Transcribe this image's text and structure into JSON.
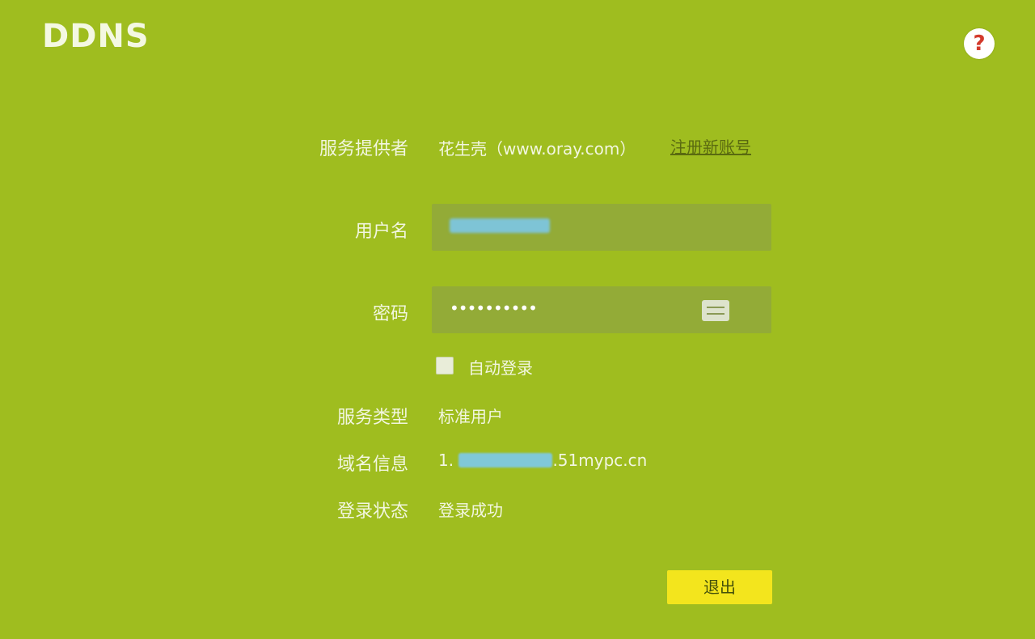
{
  "page": {
    "title": "DDNS",
    "help_icon_text": "?"
  },
  "form": {
    "provider": {
      "label": "服务提供者",
      "value": "花生壳（www.oray.com）",
      "register_link": "注册新账号"
    },
    "username": {
      "label": "用户名",
      "value": ""
    },
    "password": {
      "label": "密码",
      "value": "••••••••••"
    },
    "auto_login": {
      "label": "自动登录",
      "checked": false
    },
    "service_type": {
      "label": "服务类型",
      "value": "标准用户"
    },
    "domain_info": {
      "label": "域名信息",
      "prefix": "1.",
      "suffix": ".51mypc.cn"
    },
    "login_status": {
      "label": "登录状态",
      "value": "登录成功"
    }
  },
  "actions": {
    "logout_label": "退出"
  },
  "colors": {
    "background": "#9fbd1f",
    "button": "#f3e51d",
    "input_bg": "#93ab37"
  },
  "icons": {
    "help": "question-mark-icon",
    "password_toggle": "show-password-icon"
  }
}
